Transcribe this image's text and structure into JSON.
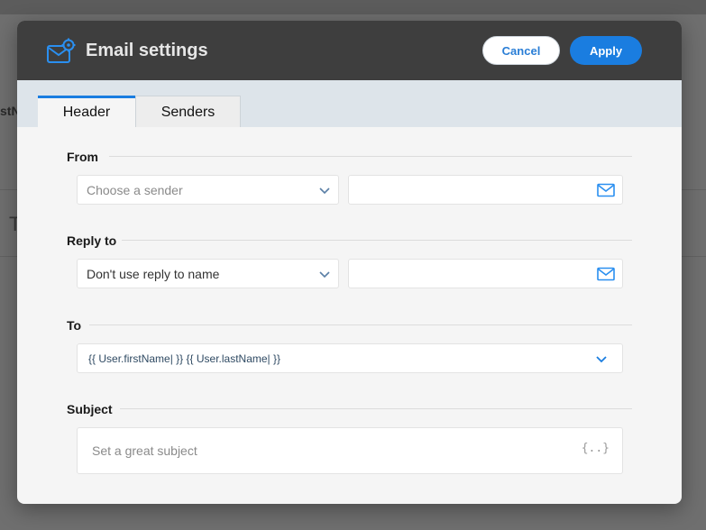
{
  "background": {
    "text_fragment_1": "stN",
    "text_fragment_2": "T"
  },
  "dialog": {
    "title": "Email settings",
    "cancel_label": "Cancel",
    "apply_label": "Apply",
    "title_icon": "email-settings-icon",
    "accent_color": "#1a7de0"
  },
  "tabs": [
    {
      "label": "Header",
      "active": true
    },
    {
      "label": "Senders",
      "active": false
    }
  ],
  "from": {
    "label": "From",
    "sender_placeholder": "Choose a sender",
    "email_value": ""
  },
  "reply_to": {
    "label": "Reply to",
    "name_value": "Don't use reply to name",
    "email_value": ""
  },
  "to": {
    "label": "To",
    "value": "{{ User.firstName| }} {{ User.lastName| }}"
  },
  "subject": {
    "label": "Subject",
    "placeholder": "Set a great subject",
    "variable_icon": "{..}"
  }
}
